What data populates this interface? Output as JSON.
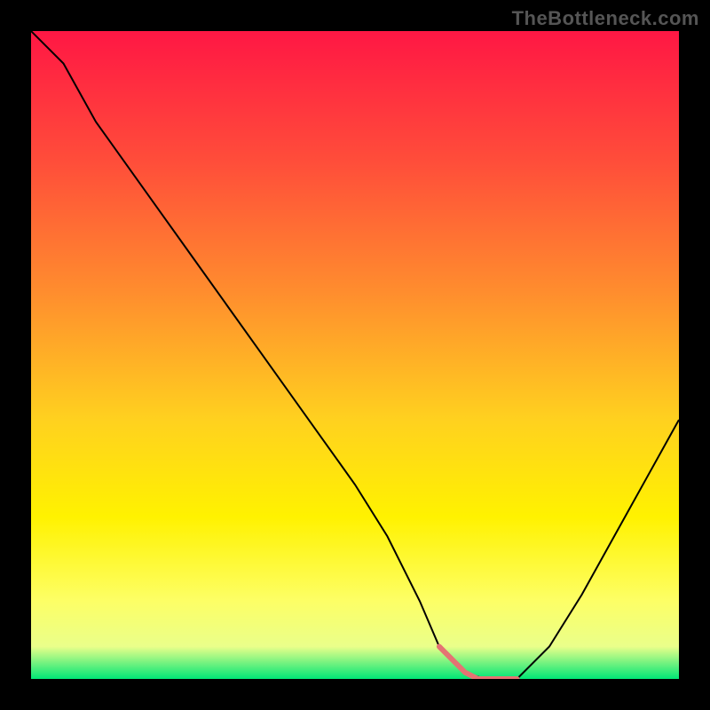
{
  "watermark": "TheBottleneck.com",
  "chart_data": {
    "type": "line",
    "title": "",
    "xlabel": "",
    "ylabel": "",
    "xlim": [
      0,
      100
    ],
    "ylim": [
      0,
      100
    ],
    "background_gradient": {
      "direction": "vertical",
      "stops": [
        {
          "pos": 0.0,
          "color": "#ff1744"
        },
        {
          "pos": 0.2,
          "color": "#ff4d3a"
        },
        {
          "pos": 0.4,
          "color": "#ff8c2e"
        },
        {
          "pos": 0.6,
          "color": "#ffd11f"
        },
        {
          "pos": 0.75,
          "color": "#fff200"
        },
        {
          "pos": 0.88,
          "color": "#fdff66"
        },
        {
          "pos": 0.95,
          "color": "#eaff8a"
        },
        {
          "pos": 1.0,
          "color": "#00e676"
        }
      ]
    },
    "series": [
      {
        "name": "main-curve",
        "color": "#000000",
        "width": 2,
        "x": [
          0,
          5,
          10,
          15,
          20,
          25,
          30,
          35,
          40,
          45,
          50,
          55,
          60,
          63,
          67,
          70,
          72,
          75,
          80,
          85,
          90,
          95,
          100
        ],
        "values": [
          100,
          95,
          86,
          79,
          72,
          65,
          58,
          51,
          44,
          37,
          30,
          22,
          12,
          5,
          1,
          0,
          0,
          0,
          5,
          13,
          22,
          31,
          40
        ]
      },
      {
        "name": "highlight-minimum",
        "color": "#e57373",
        "width": 6,
        "x": [
          63,
          65,
          67,
          69,
          71,
          73,
          75
        ],
        "values": [
          5,
          3,
          1,
          0,
          0,
          0,
          0
        ]
      }
    ]
  }
}
